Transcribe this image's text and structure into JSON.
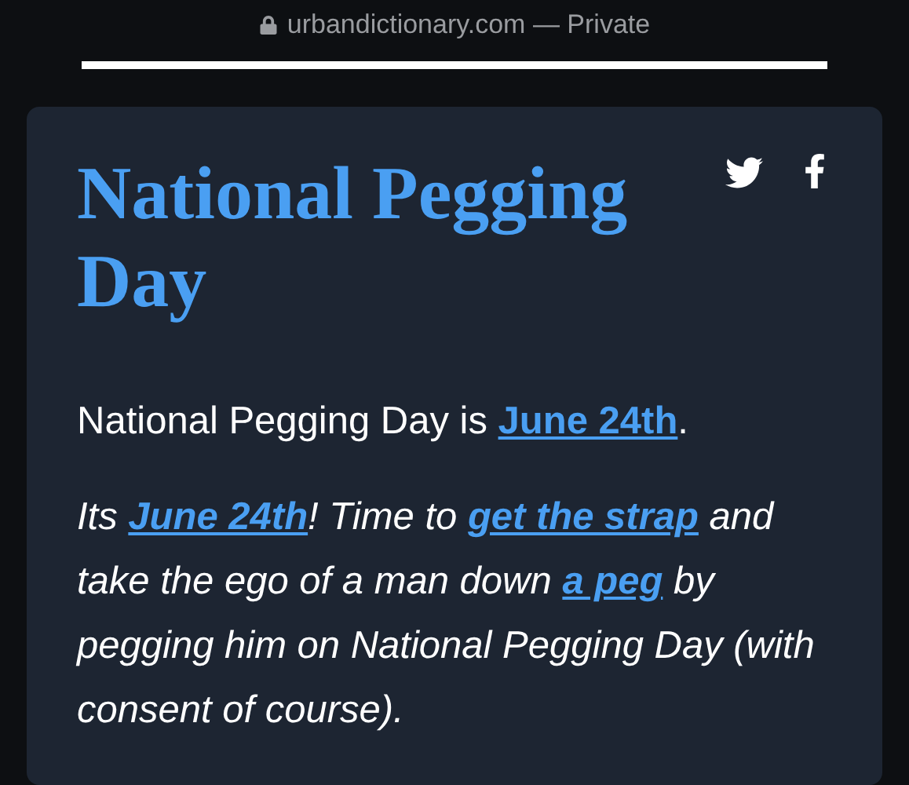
{
  "address_bar": {
    "domain": "urbandictionary.com",
    "mode": "— Private"
  },
  "entry": {
    "title": "National Pegging Day",
    "paragraphs": [
      {
        "italic": false,
        "segments": [
          {
            "text": "National Pegging Day is ",
            "link": false
          },
          {
            "text": "June 24th",
            "link": true
          },
          {
            "text": ".",
            "link": false
          }
        ]
      },
      {
        "italic": true,
        "segments": [
          {
            "text": "Its ",
            "link": false
          },
          {
            "text": "June 24th",
            "link": true
          },
          {
            "text": "! Time to ",
            "link": false
          },
          {
            "text": "get the strap",
            "link": true
          },
          {
            "text": " and take the ego of a man down ",
            "link": false
          },
          {
            "text": "a peg",
            "link": true
          },
          {
            "text": " by pegging him on National Pegging Day (with consent of course).",
            "link": false
          }
        ]
      }
    ]
  }
}
